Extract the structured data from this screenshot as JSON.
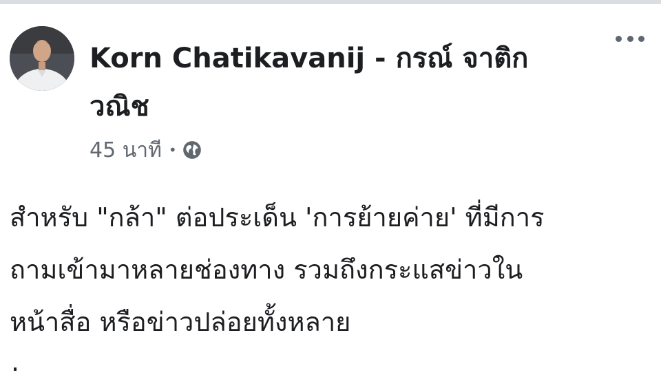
{
  "post": {
    "author_name": "Korn Chatikavanij - กรณ์ จาติกวณิช",
    "time": "45 นาที",
    "separator": "•",
    "privacy_icon": "globe-icon",
    "more_icon": "more-options-icon",
    "text_lines": [
      "สำหรับ \"กล้า\" ต่อประเด็น 'การย้ายค่าย' ที่มีการ",
      "ถามเข้ามาหลายช่องทาง รวมถึงกระแสข่าวใน",
      "หน้าสื่อ หรือข่าวปล่อยทั้งหลาย"
    ],
    "trailing_text": "."
  },
  "colors": {
    "name": "#1c1e21",
    "meta": "#606770",
    "top_bar": "#dadde1"
  }
}
